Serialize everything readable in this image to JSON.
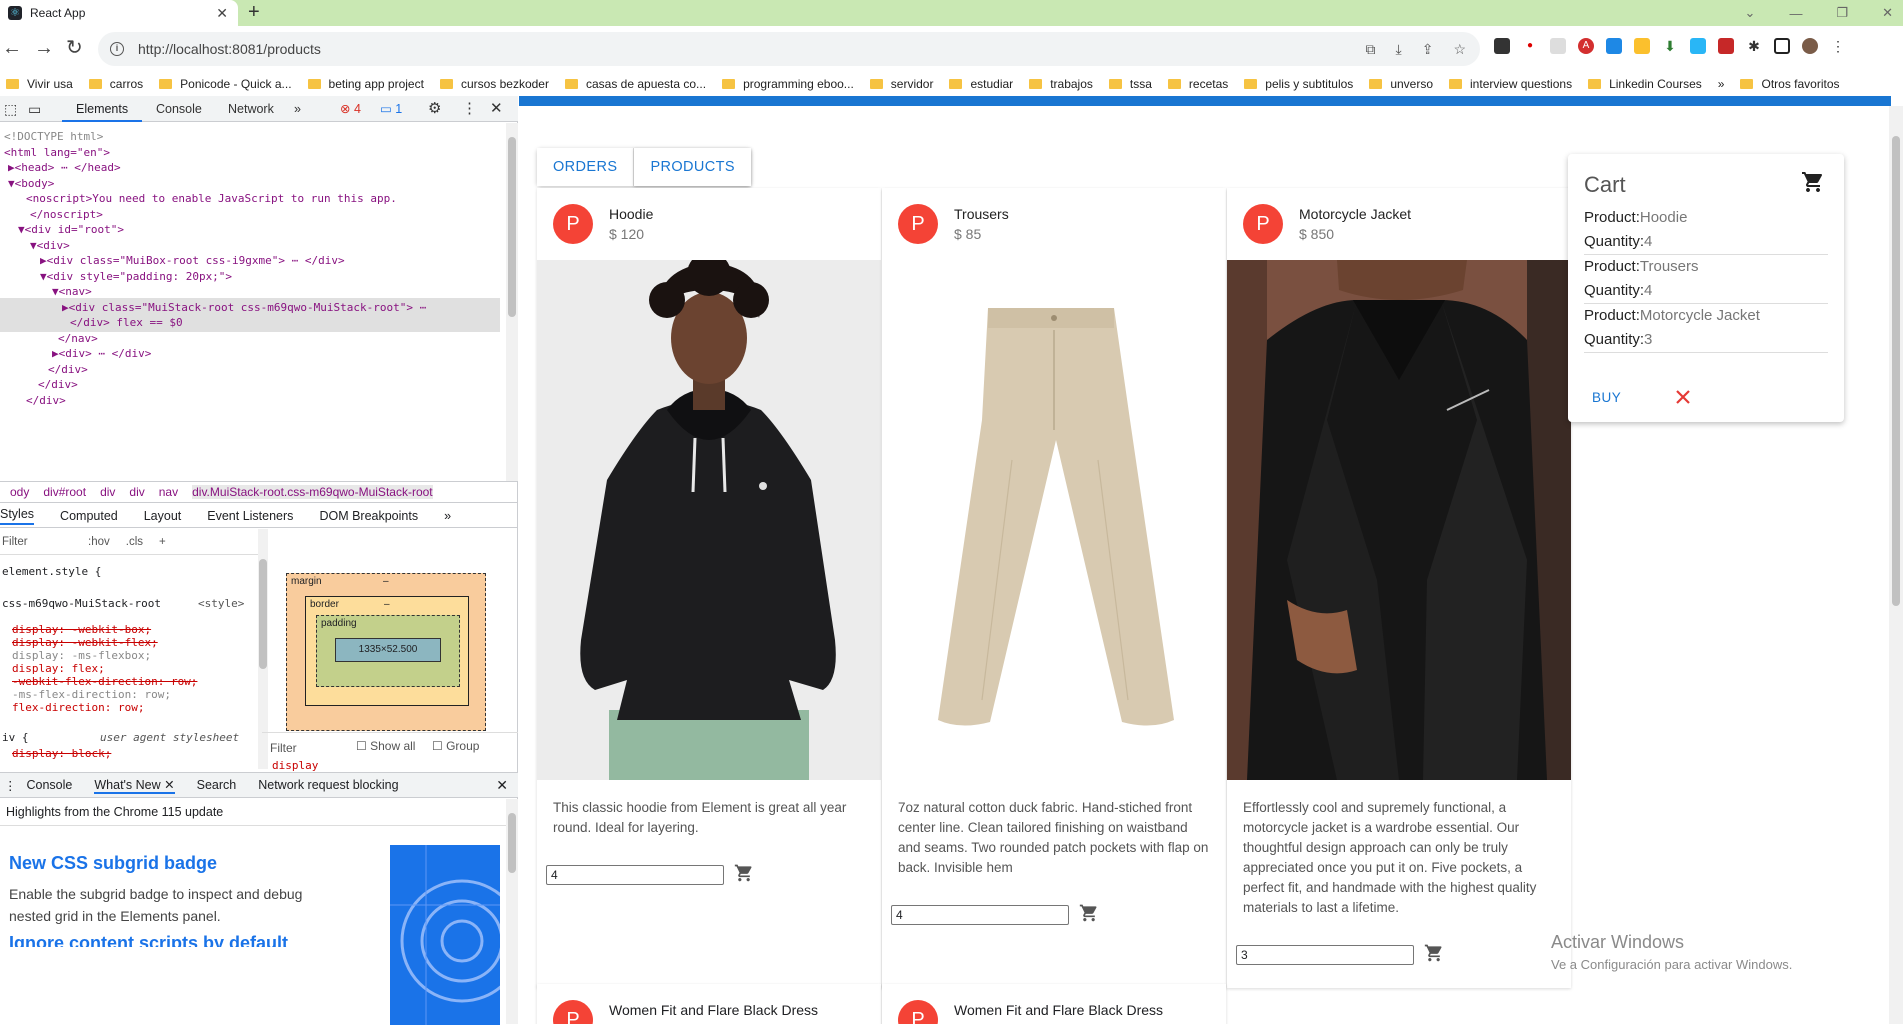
{
  "browser": {
    "tab_title": "React App",
    "tab_close": "✕",
    "new_tab": "+",
    "url": "http://localhost:8081/products",
    "bookmarks": [
      "Vivir usa",
      "carros",
      "Ponicode - Quick a...",
      "beting app project",
      "cursos bezkoder",
      "casas de apuesta co...",
      "programming eboo...",
      "servidor",
      "estudiar",
      "trabajos",
      "tssa",
      "recetas",
      "pelis y subtitulos",
      "unverso",
      "interview questions",
      "Linkedin Courses",
      "»",
      "Otros favoritos"
    ]
  },
  "devtools": {
    "tabs": [
      "Elements",
      "Console",
      "Network",
      "»"
    ],
    "errors": "4",
    "messages": "1",
    "dom_lines": [
      "<!DOCTYPE html>",
      "<html lang=\"en\">",
      "▶<head> ⋯ </head>",
      "▼<body>",
      "<noscript>You need to enable JavaScript to run this app.",
      "</noscript>",
      "▼<div id=\"root\">",
      "▼<div>",
      "▶<div class=\"MuiBox-root css-i9gxme\"> ⋯ </div>",
      "▼<div style=\"padding: 20px;\">",
      "▼<nav>",
      "▶<div class=\"MuiStack-root css-m69qwo-MuiStack-root\"> ⋯",
      "</div>  flex  == $0",
      "</nav>",
      "▶<div> ⋯ </div>",
      "</div>",
      "</div>",
      "</div>"
    ],
    "breadcrumbs": [
      "ody",
      "div#root",
      "div",
      "div",
      "nav",
      "div.MuiStack-root.css-m69qwo-MuiStack-root"
    ],
    "subtabs": [
      "Styles",
      "Computed",
      "Layout",
      "Event Listeners",
      "DOM Breakpoints",
      "»"
    ],
    "filter_placeholder": "Filter",
    "hov": ":hov",
    "cls": ".cls",
    "css_lines": [
      "element.style {",
      "css-m69qwo-MuiStack-root",
      "display: -webkit-box;",
      "display: -webkit-flex;",
      "display: -ms-flexbox;",
      "display: flex;",
      "-webkit-flex-direction: row;",
      "-ms-flex-direction: row;",
      "flex-direction: row;",
      "iv {",
      "display: block;"
    ],
    "style_source": "<style>",
    "ua_stylesheet": "user agent stylesheet",
    "box_model": {
      "margin": "margin",
      "border": "border",
      "padding": "padding",
      "content": "1335×52.500",
      "dash": "–"
    },
    "computed_filter": "Filter",
    "show_all": "Show all",
    "group": "Group",
    "display_prop": "display",
    "drawer_tabs": [
      "Console",
      "What's New ✕",
      "Search",
      "Network request blocking"
    ],
    "whats_new_header": "Highlights from the Chrome 115 update",
    "whats_new_title": "New CSS subgrid badge",
    "whats_new_body": "Enable the subgrid badge to inspect and debug nested grid in the Elements panel.",
    "whats_new_next": "Ignore content scripts by default"
  },
  "app": {
    "tabs": [
      "ORDERS",
      "PRODUCTS"
    ],
    "products": [
      {
        "initial": "P",
        "name": "Hoodie",
        "price": "$ 120",
        "description": "This classic hoodie from Element is great all year round. Ideal for layering.",
        "quantity": "4"
      },
      {
        "initial": "P",
        "name": "Trousers",
        "price": "$ 85",
        "description": "7oz natural cotton duck fabric. Hand-stiched front center line. Clean tailored finishing on waistband and seams. Two rounded patch pockets with flap on back. Invisible hem",
        "quantity": "4"
      },
      {
        "initial": "P",
        "name": "Motorcycle Jacket",
        "price": "$ 850",
        "description": "Effortlessly cool and supremely functional, a motorcycle jacket is a wardrobe essential. Our thoughtful design approach can only be truly appreciated once you put it on. Five pockets, a perfect fit, and handmade with the highest quality materials to last a lifetime.",
        "quantity": "3"
      }
    ],
    "next_row": [
      {
        "initial": "P",
        "name": "Women Fit and Flare Black Dress"
      },
      {
        "initial": "P",
        "name": "Women Fit and Flare Black Dress"
      }
    ],
    "cart": {
      "title": "Cart",
      "items": [
        {
          "product_label": "Product:",
          "product": "Hoodie",
          "quantity_label": "Quantity:",
          "quantity": "4"
        },
        {
          "product_label": "Product:",
          "product": "Trousers",
          "quantity_label": "Quantity:",
          "quantity": "4"
        },
        {
          "product_label": "Product:",
          "product": "Motorcycle Jacket",
          "quantity_label": "Quantity:",
          "quantity": "3"
        }
      ],
      "buy": "BUY"
    },
    "watermark_title": "Activar Windows",
    "watermark_sub": "Ve a Configuración para activar Windows."
  },
  "colors": {
    "appbar": "#1976d2",
    "avatar": "#f44336",
    "tabstrip": "#c9e8b3"
  }
}
